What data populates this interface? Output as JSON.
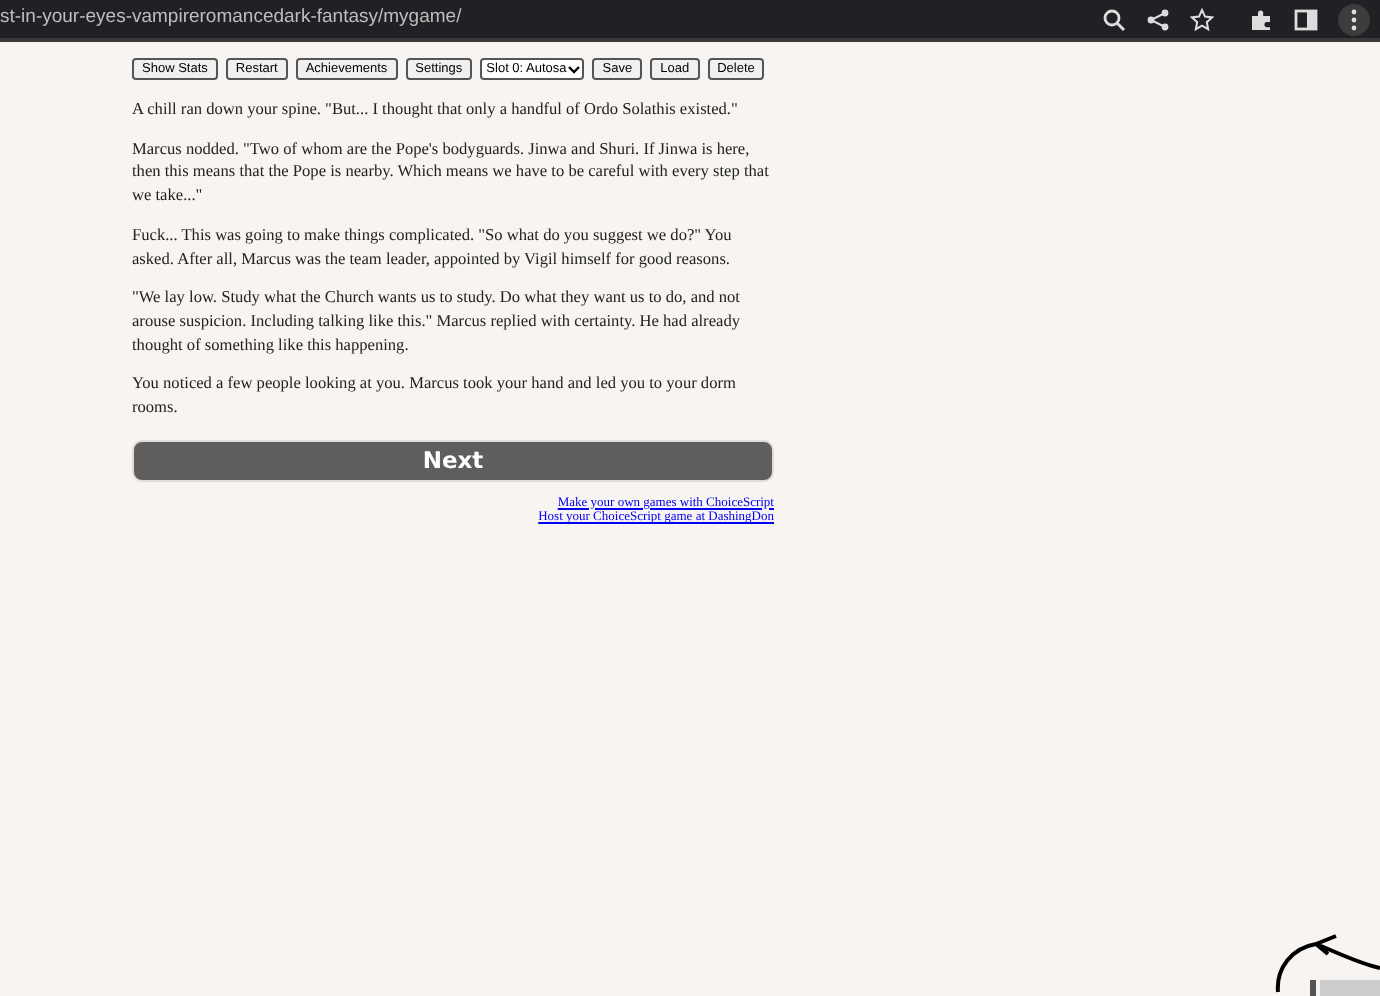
{
  "browser": {
    "url": "st-in-your-eyes-vampireromancedark-fantasy/mygame/"
  },
  "toolbar": {
    "buttons": [
      "Show Stats",
      "Restart",
      "Achievements",
      "Settings"
    ],
    "slot_select": {
      "value": "Slot 0: Autosa"
    },
    "slot_buttons": [
      "Save",
      "Load",
      "Delete"
    ]
  },
  "paragraphs": [
    "A chill ran down your spine. \"But... I thought that only a handful of Ordo Solathis existed.\"",
    "Marcus nodded. \"Two of whom are the Pope's bodyguards. Jinwa and Shuri. If Jinwa is here, then this means that the Pope is nearby. Which means we have to be careful with every step that we take...\"",
    "Fuck... This was going to make things complicated. \"So what do you suggest we do?\" You asked. After all, Marcus was the team leader, appointed by Vigil himself for good reasons.",
    "\"We lay low. Study what the Church wants us to study. Do what they want us to do, and not arouse suspicion. Including talking like this.\" Marcus replied with certainty. He had already thought of something like this happening.",
    "You noticed a few people looking at you. Marcus took your hand and led you to your dorm rooms."
  ],
  "next_button": "Next",
  "links": [
    "Make your own games with ChoiceScript",
    "Host your ChoiceScript game at DashingDon"
  ]
}
